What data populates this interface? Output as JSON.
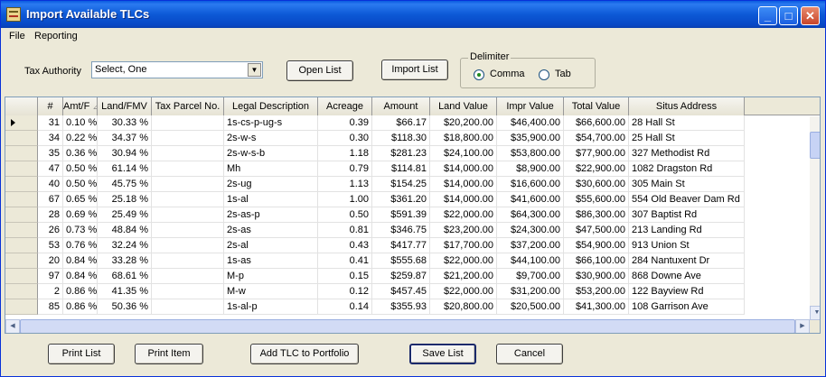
{
  "window": {
    "title": "Import Available TLCs"
  },
  "menu": [
    "File",
    "Reporting"
  ],
  "toolbar": {
    "tax_authority_label": "Tax Authority",
    "tax_authority_value": "Select, One",
    "open_list": "Open List",
    "import_list": "Import List",
    "delimiter_label": "Delimiter",
    "comma": "Comma",
    "tab": "Tab",
    "selected_delimiter": "Comma"
  },
  "table": {
    "columns": [
      "#",
      "Amt/F",
      "Land/FMV",
      "Tax Parcel No.",
      "Legal Description",
      "Acreage",
      "Amount",
      "Land Value",
      "Impr Value",
      "Total Value",
      "Situs Address"
    ],
    "sort_indicator": "⊿",
    "rows": [
      [
        "31",
        "0.10 %",
        "30.33 %",
        "",
        "1s-cs-p-ug-s",
        "0.39",
        "$66.17",
        "$20,200.00",
        "$46,400.00",
        "$66,600.00",
        "28 Hall St"
      ],
      [
        "34",
        "0.22 %",
        "34.37 %",
        "",
        "2s-w-s",
        "0.30",
        "$118.30",
        "$18,800.00",
        "$35,900.00",
        "$54,700.00",
        "25 Hall St"
      ],
      [
        "35",
        "0.36 %",
        "30.94 %",
        "",
        "2s-w-s-b",
        "1.18",
        "$281.23",
        "$24,100.00",
        "$53,800.00",
        "$77,900.00",
        "327 Methodist Rd"
      ],
      [
        "47",
        "0.50 %",
        "61.14 %",
        "",
        "Mh",
        "0.79",
        "$114.81",
        "$14,000.00",
        "$8,900.00",
        "$22,900.00",
        "1082 Dragston Rd"
      ],
      [
        "40",
        "0.50 %",
        "45.75 %",
        "",
        "2s-ug",
        "1.13",
        "$154.25",
        "$14,000.00",
        "$16,600.00",
        "$30,600.00",
        "305 Main St"
      ],
      [
        "67",
        "0.65 %",
        "25.18 %",
        "",
        "1s-al",
        "1.00",
        "$361.20",
        "$14,000.00",
        "$41,600.00",
        "$55,600.00",
        "554 Old Beaver Dam Rd"
      ],
      [
        "28",
        "0.69 %",
        "25.49 %",
        "",
        "2s-as-p",
        "0.50",
        "$591.39",
        "$22,000.00",
        "$64,300.00",
        "$86,300.00",
        "307 Baptist Rd"
      ],
      [
        "26",
        "0.73 %",
        "48.84 %",
        "",
        "2s-as",
        "0.81",
        "$346.75",
        "$23,200.00",
        "$24,300.00",
        "$47,500.00",
        "213 Landing Rd"
      ],
      [
        "53",
        "0.76 %",
        "32.24 %",
        "",
        "2s-al",
        "0.43",
        "$417.77",
        "$17,700.00",
        "$37,200.00",
        "$54,900.00",
        "913 Union St"
      ],
      [
        "20",
        "0.84 %",
        "33.28 %",
        "",
        "1s-as",
        "0.41",
        "$555.68",
        "$22,000.00",
        "$44,100.00",
        "$66,100.00",
        "284 Nantuxent Dr"
      ],
      [
        "97",
        "0.84 %",
        "68.61 %",
        "",
        "M-p",
        "0.15",
        "$259.87",
        "$21,200.00",
        "$9,700.00",
        "$30,900.00",
        "868 Downe Ave"
      ],
      [
        "2",
        "0.86 %",
        "41.35 %",
        "",
        "M-w",
        "0.12",
        "$457.45",
        "$22,000.00",
        "$31,200.00",
        "$53,200.00",
        "122 Bayview Rd"
      ],
      [
        "85",
        "0.86 %",
        "50.36 %",
        "",
        "1s-al-p",
        "0.14",
        "$355.93",
        "$20,800.00",
        "$20,500.00",
        "$41,300.00",
        "108 Garrison Ave"
      ]
    ]
  },
  "buttons": {
    "print_list": "Print List",
    "print_item": "Print Item",
    "add_tlc": "Add TLC to Portfolio",
    "save_list": "Save List",
    "cancel": "Cancel"
  }
}
